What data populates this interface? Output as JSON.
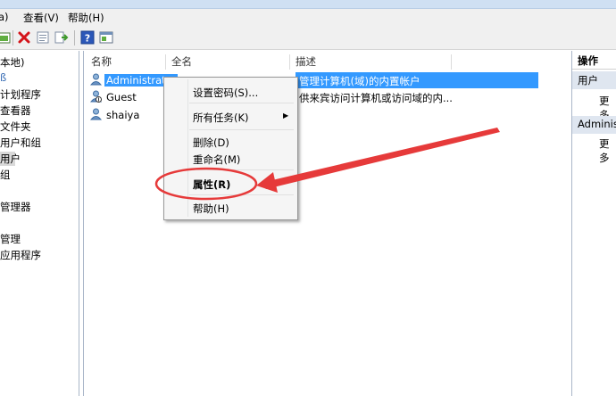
{
  "menubar": {
    "partial_left": "a)",
    "view": "查看(V)",
    "help": "帮助(H)"
  },
  "tree": {
    "items": [
      "本地)",
      "ß",
      "计划程序",
      "查看器",
      "文件夹",
      "用户和组",
      "用户",
      "组",
      "管理器",
      "",
      "管理",
      "应用程序"
    ]
  },
  "list": {
    "columns": {
      "name": "名称",
      "fullname": "全名",
      "desc": "描述"
    },
    "rows": [
      {
        "name": "Administrat...",
        "desc": "管理计算机(域)的内置帐户"
      },
      {
        "name": "Guest",
        "desc": "供来宾访问计算机或访问域的内..."
      },
      {
        "name": "shaiya",
        "desc": ""
      }
    ]
  },
  "actions": {
    "header": "操作",
    "group1": "用户",
    "more1": "更多",
    "group2": "Adminis",
    "more2": "更多"
  },
  "context_menu": {
    "set_password": "设置密码(S)...",
    "all_tasks": "所有任务(K)",
    "delete": "删除(D)",
    "rename": "重命名(M)",
    "properties": "属性(R)",
    "help": "帮助(H)"
  },
  "annotation_color": "#e63a3a"
}
